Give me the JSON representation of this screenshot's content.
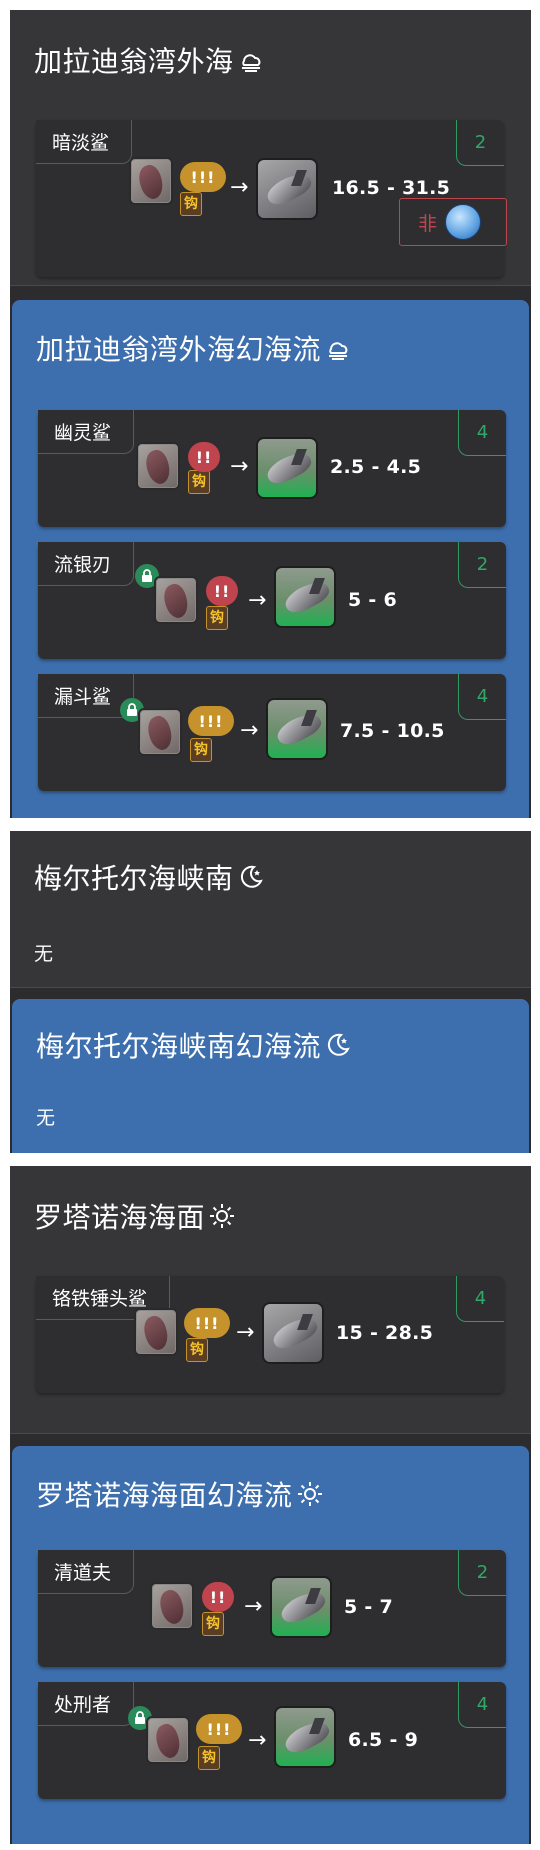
{
  "sections": {
    "s1": {
      "title": "加拉迪翁湾外海",
      "weather_icon": "cloud-rain-icon"
    },
    "s2": {
      "title": "加拉迪翁湾外海幻海流",
      "weather_icon": "cloud-rain-icon"
    },
    "s3": {
      "title": "梅尔托尔海峡南",
      "weather_icon": "crescent-moon-icon",
      "empty_label": "无"
    },
    "s4": {
      "title": "梅尔托尔海峡南幻海流",
      "weather_icon": "crescent-moon-icon",
      "empty_label": "无"
    },
    "s5": {
      "title": "罗塔诺海海面",
      "weather_icon": "sun-icon"
    },
    "s6": {
      "title": "罗塔诺海海面幻海流",
      "weather_icon": "sun-icon"
    }
  },
  "cards": {
    "c1": {
      "name": "暗淡鲨",
      "count": "2",
      "tug": "!!!",
      "range": "16.5 - 31.5",
      "weather_prefix": "非",
      "weather_orb": "rain-orb-icon",
      "locked": false
    },
    "c2": {
      "name": "幽灵鲨",
      "count": "4",
      "tug": "!!",
      "range": "2.5 - 4.5",
      "locked": false
    },
    "c3": {
      "name": "流银刃",
      "count": "2",
      "tug": "!!",
      "range": "5 - 6",
      "locked": true
    },
    "c4": {
      "name": "漏斗鲨",
      "count": "4",
      "tug": "!!!",
      "range": "7.5 - 10.5",
      "locked": true
    },
    "c5": {
      "name": "铬铁锤头鲨",
      "count": "4",
      "tug": "!!!",
      "range": "15 - 28.5",
      "locked": false
    },
    "c6": {
      "name": "清道夫",
      "count": "2",
      "tug": "!!",
      "range": "5 - 7",
      "locked": false
    },
    "c7": {
      "name": "处刑者",
      "count": "4",
      "tug": "!!!",
      "range": "6.5 - 9",
      "locked": true
    }
  },
  "arrow": "→",
  "hook_glyph": "钩",
  "colors": {
    "blue_section": "#3d6fae",
    "count_green": "#2fa868",
    "tug_gold": "#c6922b",
    "tug_red": "#c0444e",
    "lock_green": "#2b8a5a"
  }
}
